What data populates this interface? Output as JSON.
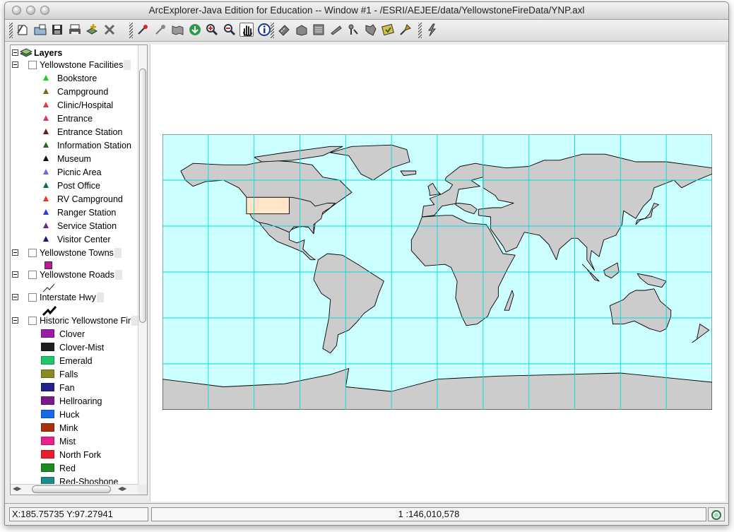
{
  "window": {
    "title": "ArcExplorer-Java Edition for Education -- Window #1 - /ESRI/AEJEE/data/YellowstoneFireData/YNP.axl"
  },
  "toolbar": {
    "buttons": [
      {
        "icon": "new-project-icon"
      },
      {
        "icon": "open-project-icon"
      },
      {
        "icon": "save-icon"
      },
      {
        "icon": "print-icon"
      },
      {
        "icon": "add-layer-icon"
      },
      {
        "icon": "delete-layer-icon"
      },
      {
        "icon": "zoom-in-arrow-icon"
      },
      {
        "icon": "zoom-out-arrow-icon"
      },
      {
        "icon": "zoom-extent-icon"
      },
      {
        "icon": "zoom-layer-icon"
      },
      {
        "icon": "zoom-in-icon"
      },
      {
        "icon": "zoom-out-icon"
      },
      {
        "icon": "pan-hand-icon",
        "active": true
      },
      {
        "icon": "identify-icon"
      },
      {
        "icon": "measure-icon"
      },
      {
        "icon": "find-icon"
      },
      {
        "icon": "query-icon"
      },
      {
        "icon": "select-icon"
      },
      {
        "icon": "clear-selection-icon"
      },
      {
        "icon": "buffer-icon"
      },
      {
        "icon": "hotlink-icon"
      },
      {
        "icon": "projection-icon"
      },
      {
        "icon": "lightning-icon"
      }
    ]
  },
  "legend": {
    "root_label": "Layers",
    "layers": [
      {
        "name": "Yellowstone Facilities",
        "checked": false,
        "items": [
          {
            "label": "Bookstore",
            "color": "#22cc22"
          },
          {
            "label": "Campground",
            "color": "#7a6a22"
          },
          {
            "label": "Clinic/Hospital",
            "color": "#e03a3a"
          },
          {
            "label": "Entrance",
            "color": "#d63a7a"
          },
          {
            "label": "Entrance Station",
            "color": "#6a1a1a"
          },
          {
            "label": "Information Station",
            "color": "#1f6a22"
          },
          {
            "label": "Museum",
            "color": "#111111"
          },
          {
            "label": "Picnic Area",
            "color": "#6a6ae8"
          },
          {
            "label": "Post Office",
            "color": "#106a5a"
          },
          {
            "label": "RV Campground",
            "color": "#e03a2a"
          },
          {
            "label": "Ranger Station",
            "color": "#2a3ae0"
          },
          {
            "label": "Service Station",
            "color": "#6a2a8a"
          },
          {
            "label": "Visitor Center",
            "color": "#1a1a6a"
          }
        ]
      },
      {
        "name": "Yellowstone Towns",
        "checked": false,
        "symbol": "square",
        "color": "#bb1a9a"
      },
      {
        "name": "Yellowstone Roads",
        "checked": false,
        "symbol": "thin-line"
      },
      {
        "name": "Interstate Hwy",
        "checked": false,
        "symbol": "thick-line"
      },
      {
        "name": "Historic Yellowstone Fir",
        "checked": false,
        "items": [
          {
            "label": "Clover",
            "color": "#9a1aa8"
          },
          {
            "label": "Clover-Mist",
            "color": "#1e1e1e"
          },
          {
            "label": "Emerald",
            "color": "#1ec86a"
          },
          {
            "label": "Falls",
            "color": "#8a8a22"
          },
          {
            "label": "Fan",
            "color": "#22228a"
          },
          {
            "label": "Hellroaring",
            "color": "#7a1a8a"
          },
          {
            "label": "Huck",
            "color": "#1a6ae8"
          },
          {
            "label": "Mink",
            "color": "#a8300a"
          },
          {
            "label": "Mist",
            "color": "#e8228a"
          },
          {
            "label": "North Fork",
            "color": "#e81e2a"
          },
          {
            "label": "Red",
            "color": "#1e8a22"
          },
          {
            "label": "Red-Shoshone",
            "color": "#1e8a8a"
          }
        ]
      }
    ]
  },
  "map": {
    "ocean_color": "#ccffff",
    "land_color": "#cccccc",
    "highlight_color": "#ffe6c8",
    "grid_color": "#00dcdc"
  },
  "status": {
    "coordinates": "X:185.75735 Y:97.27941",
    "scale": "1 :146,010,578"
  }
}
